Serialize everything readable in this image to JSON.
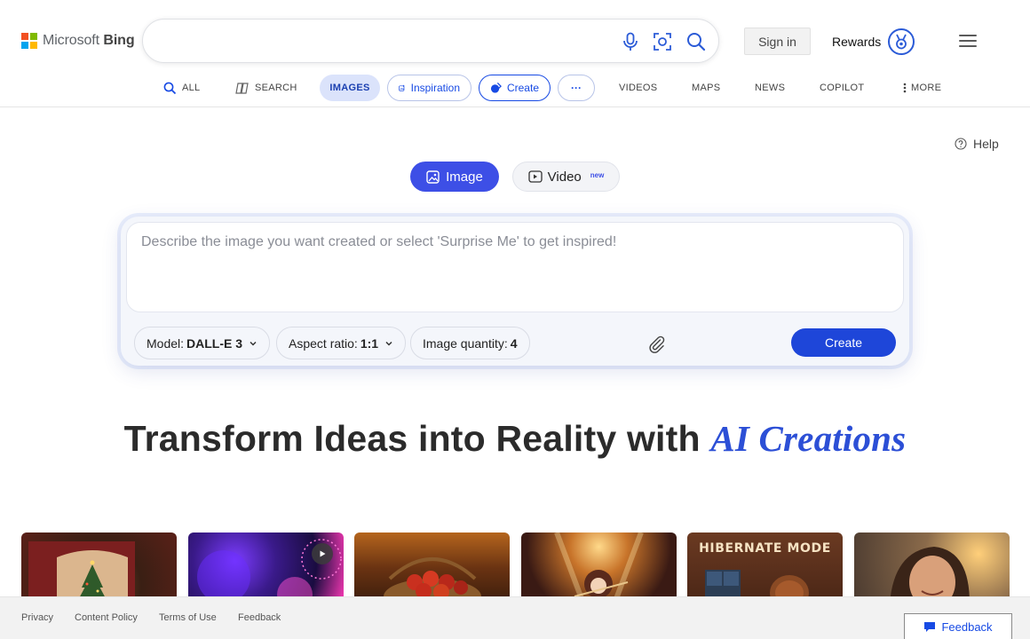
{
  "header": {
    "brand": "Microsoft",
    "brand_product": "Bing",
    "logo_colors": [
      "#f25022",
      "#7fba00",
      "#00a4ef",
      "#ffb900"
    ],
    "search_value": "",
    "search_placeholder": "",
    "sign_in_label": "Sign in",
    "rewards_label": "Rewards",
    "icons": [
      "microphone-icon",
      "visual-search-icon",
      "search-icon",
      "medal-icon",
      "hamburger-icon"
    ]
  },
  "nav": {
    "all": "ALL",
    "search": "SEARCH",
    "images": "IMAGES",
    "inspiration": "Inspiration",
    "create": "Create",
    "more_dots": "···",
    "videos": "VIDEOS",
    "maps": "MAPS",
    "news": "NEWS",
    "copilot": "COPILOT",
    "more": "MORE"
  },
  "help_label": "Help",
  "mode": {
    "image_label": "Image",
    "video_label": "Video",
    "video_badge": "new",
    "selected": "Image"
  },
  "composer": {
    "prompt_value": "",
    "prompt_placeholder": "Describe the image you want created or select 'Surprise Me' to get inspired!",
    "model_label": "Model:",
    "model_value": "DALL-E 3",
    "aspect_label": "Aspect ratio:",
    "aspect_value": "1:1",
    "quantity_label": "Image quantity:",
    "quantity_value": "4",
    "create_label": "Create"
  },
  "headline": {
    "text": "Transform Ideas into Reality with",
    "accent": "AI Creations"
  },
  "gallery": [
    {
      "name": "christmas-card",
      "label": ""
    },
    {
      "name": "fireworks-video",
      "label": "",
      "is_video": true
    },
    {
      "name": "apple-basket",
      "label": ""
    },
    {
      "name": "anime-violinist",
      "label": ""
    },
    {
      "name": "hibernate-mode-poster",
      "label": "HIBERNATE MODE"
    },
    {
      "name": "smiling-woman",
      "label": ""
    }
  ],
  "footer": {
    "privacy": "Privacy",
    "content_policy": "Content Policy",
    "terms": "Terms of Use",
    "feedback_link": "Feedback",
    "feedback_button": "Feedback"
  },
  "colors": {
    "accent": "#3d4fe6",
    "create_button": "#1e46d9",
    "headline_accent": "#2c4fd6"
  }
}
